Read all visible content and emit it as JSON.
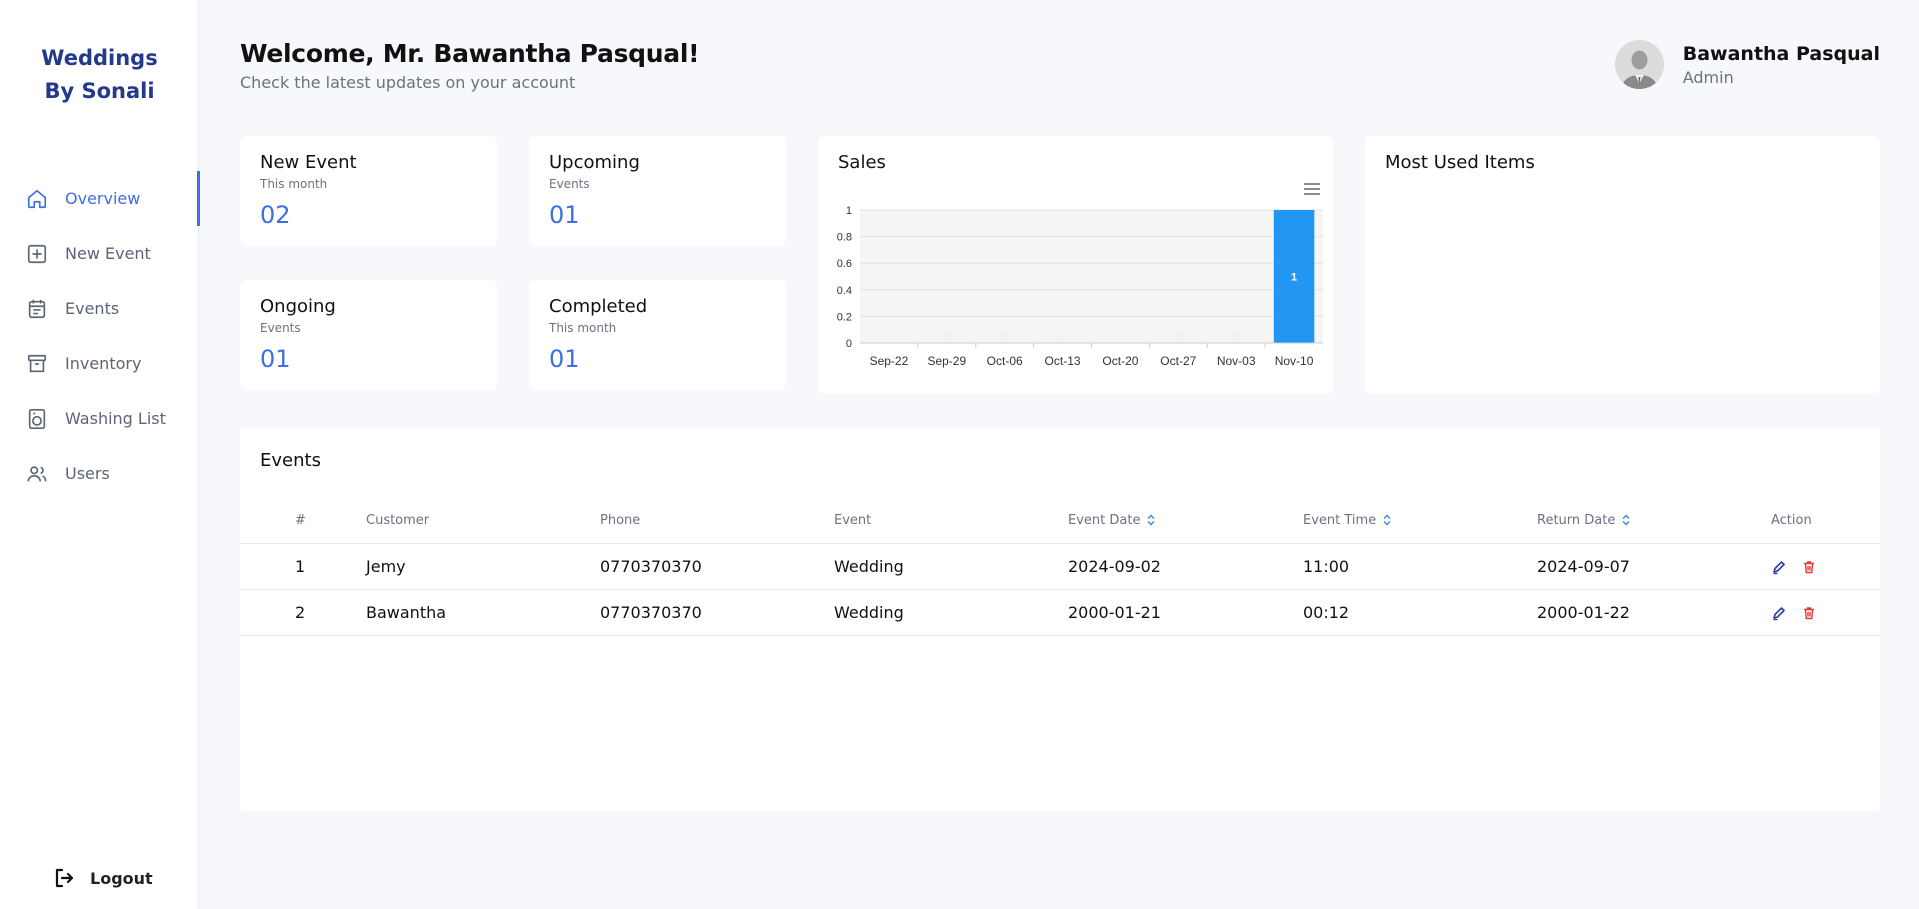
{
  "brand": {
    "line1": "Weddings",
    "line2": "By Sonali"
  },
  "sidebar": {
    "items": [
      {
        "label": "Overview",
        "icon": "home-icon",
        "active": true
      },
      {
        "label": "New Event",
        "icon": "plus-square-icon",
        "active": false
      },
      {
        "label": "Events",
        "icon": "calendar-list-icon",
        "active": false
      },
      {
        "label": "Inventory",
        "icon": "archive-box-icon",
        "active": false
      },
      {
        "label": "Washing List",
        "icon": "washing-machine-icon",
        "active": false
      },
      {
        "label": "Users",
        "icon": "users-icon",
        "active": false
      }
    ],
    "logout_label": "Logout"
  },
  "header": {
    "welcome": "Welcome, Mr. Bawantha Pasqual!",
    "subtitle": "Check the latest updates on your account"
  },
  "profile": {
    "name": "Bawantha Pasqual",
    "role": "Admin"
  },
  "stats": {
    "new_event": {
      "title": "New Event",
      "sub": "This month",
      "value": "02"
    },
    "upcoming": {
      "title": "Upcoming",
      "sub": "Events",
      "value": "01"
    },
    "ongoing": {
      "title": "Ongoing",
      "sub": "Events",
      "value": "01"
    },
    "completed": {
      "title": "Completed",
      "sub": "This month",
      "value": "01"
    }
  },
  "sales": {
    "title": "Sales"
  },
  "most_used": {
    "title": "Most Used Items"
  },
  "chart_data": {
    "type": "bar",
    "title": "Sales",
    "categories": [
      "Sep-22",
      "Sep-29",
      "Oct-06",
      "Oct-13",
      "Oct-20",
      "Oct-27",
      "Nov-03",
      "Nov-10"
    ],
    "values": [
      0,
      0,
      0,
      0,
      0,
      0,
      0,
      1
    ],
    "data_labels": [
      "0",
      "0",
      "0",
      "0",
      "0",
      "0",
      "0",
      "1"
    ],
    "yticks": [
      "0",
      "0.2",
      "0.4",
      "0.6",
      "0.8",
      "1"
    ],
    "ylim": [
      0,
      1
    ],
    "grid": true,
    "bar_color": "#2196f3",
    "xlabel": "",
    "ylabel": ""
  },
  "events": {
    "title": "Events",
    "columns": [
      "#",
      "Customer",
      "Phone",
      "Event",
      "Event Date",
      "Event Time",
      "Return Date",
      "Action"
    ],
    "rows": [
      {
        "num": "1",
        "customer": "Jemy",
        "phone": "0770370370",
        "event": "Wedding",
        "event_date": "2024-09-02",
        "event_time": "11:00",
        "return_date": "2024-09-07"
      },
      {
        "num": "2",
        "customer": "Bawantha",
        "phone": "0770370370",
        "event": "Wedding",
        "event_date": "2000-01-21",
        "event_time": "00:12",
        "return_date": "2000-01-22"
      }
    ]
  },
  "colors": {
    "accent": "#3e6ee4",
    "brand": "#24388c",
    "bar": "#2196f3",
    "delete": "#e53935",
    "edit": "#2b3f97"
  }
}
